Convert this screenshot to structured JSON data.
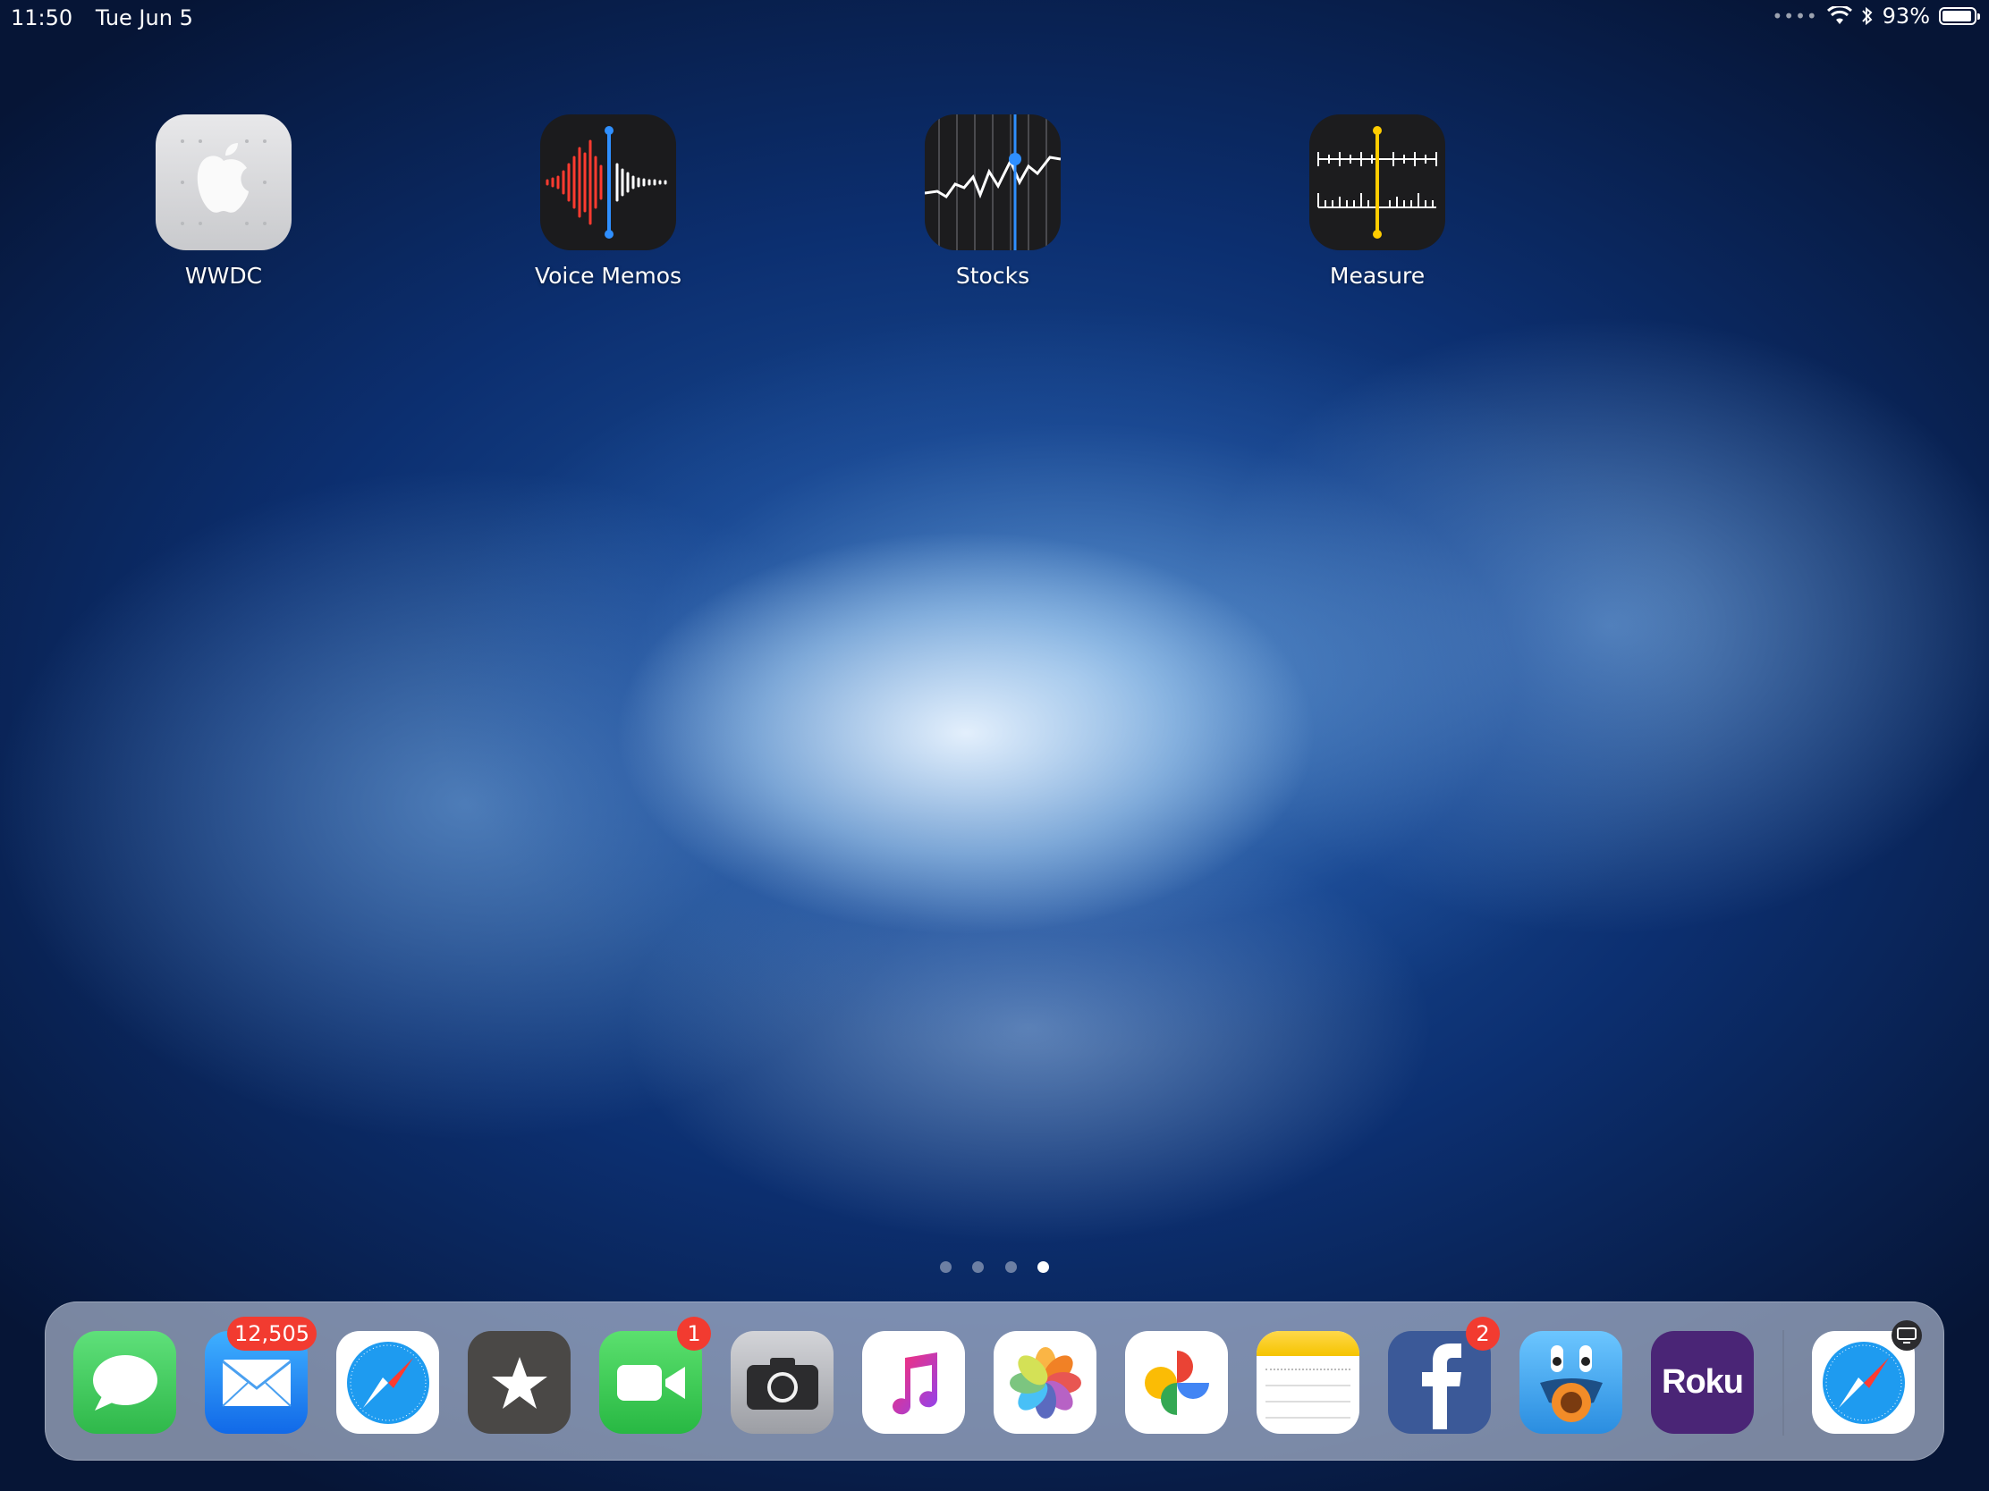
{
  "status_bar": {
    "time": "11:50",
    "date": "Tue Jun 5",
    "battery": "93%",
    "battery_level": 0.93
  },
  "home_apps": [
    {
      "label": "WWDC",
      "icon": "apple-logo-icon"
    },
    {
      "label": "Voice Memos",
      "icon": "waveform-icon"
    },
    {
      "label": "Stocks",
      "icon": "stock-chart-icon"
    },
    {
      "label": "Measure",
      "icon": "ruler-icon"
    }
  ],
  "page_indicator": {
    "pages": 4,
    "current": 4
  },
  "dock": {
    "apps": [
      {
        "name": "Messages",
        "icon": "speech-bubble-icon",
        "color": "#34c759"
      },
      {
        "name": "Mail",
        "icon": "envelope-icon",
        "color": "#1a8cff",
        "badge": "12,505"
      },
      {
        "name": "Safari",
        "icon": "compass-icon",
        "color": "#ffffff"
      },
      {
        "name": "iTunes Store",
        "icon": "star-icon",
        "color": "#4a4a4c"
      },
      {
        "name": "FaceTime",
        "icon": "video-camera-icon",
        "color": "#33c24f",
        "badge": "1"
      },
      {
        "name": "Camera",
        "icon": "camera-icon",
        "color": "#8e8e93"
      },
      {
        "name": "Music",
        "icon": "music-note-icon",
        "color": "#ffffff"
      },
      {
        "name": "Photos",
        "icon": "pinwheel-icon",
        "color": "#ffffff"
      },
      {
        "name": "Google Photos",
        "icon": "google-pinwheel-icon",
        "color": "#ffffff"
      },
      {
        "name": "Notes",
        "icon": "notepad-icon",
        "color": "#ffffff"
      },
      {
        "name": "Facebook",
        "icon": "facebook-f-icon",
        "color": "#3b5998",
        "badge": "2"
      },
      {
        "name": "Tweetbot",
        "icon": "bird-icon",
        "color": "#3aa9f3"
      },
      {
        "name": "Roku",
        "icon": "roku-wordmark-icon",
        "color": "#4a2a7a",
        "text": "Roku"
      }
    ],
    "recent": {
      "name": "Safari",
      "icon": "compass-icon",
      "color": "#ffffff",
      "handoff_icon": "display-icon"
    }
  }
}
